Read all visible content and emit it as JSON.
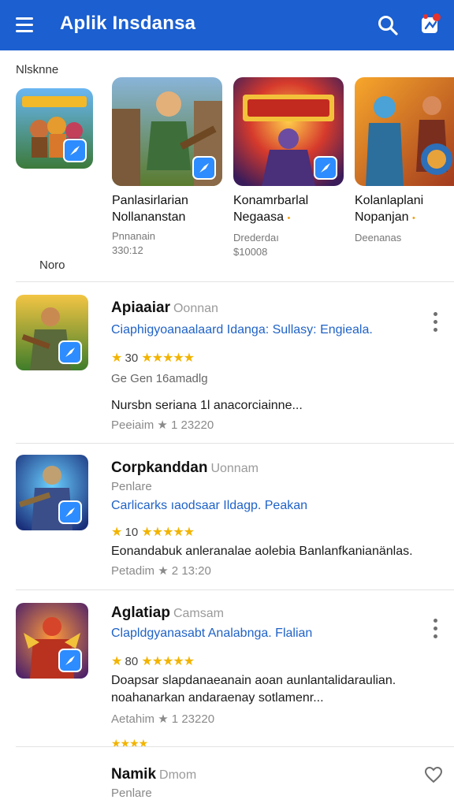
{
  "header": {
    "title": "Aplik Insdansa",
    "menu_icon": "menu-icon",
    "search_icon": "search-icon",
    "apps_icon": "app-badge-icon",
    "color": "#1b5fd0"
  },
  "featured": {
    "label": "Nlsknne",
    "sub_label": "Noro",
    "cards": [
      {
        "name_line1": "Panlasirlarian",
        "name_line2": "Nollananstan",
        "meta_line1": "Pnnanain",
        "meta_line2": "330:12",
        "marker": ""
      },
      {
        "name_line1": "Konamrbarlal",
        "name_line2": "Negaasa",
        "meta_line1": "Drederdaı",
        "meta_line2": "$10008",
        "marker": "•"
      },
      {
        "name_line1": "Kolanlaplani",
        "name_line2": "Nopanjan",
        "meta_line1": "Deenanas",
        "meta_line2": "",
        "marker": "•"
      }
    ]
  },
  "list": [
    {
      "title": "Apiaaiar",
      "developer": "Oonnan",
      "tagline": "Ciaphigyoanaalaard Idanga: Sullasy: Engieala.",
      "rating": "30",
      "stars": "★★★★★",
      "plain": "Ge Gen 16amadlg",
      "description": "Nursbn seriana 1l anacorciainne...",
      "footer": "Peeiaim ★ 1 23220"
    },
    {
      "title": "Corpkanddan",
      "developer": "Uonnam",
      "subtitle": "Penlare",
      "tagline": "Carlicarks ıaodsaar Ildagp. Peakan",
      "rating": "10",
      "stars": "★★★★★",
      "description": "Eonandabuk anleranalae aolebia Banlanfkanianänlas.",
      "footer": "Petadim ★ 2 13:20"
    },
    {
      "title": "Aglatiap",
      "developer": "Camsam",
      "tagline": "Clapldgyanasabt Analabnga. Flalian",
      "rating": "80",
      "stars": "★★★★★",
      "description": "Doapsar slapdanaeanain aoan aunlantalidaraulian. noahanarkan andaraenay sotlamenr...",
      "footer": "Aetahim ★ 1 23220",
      "trailing_stars": "★★★★"
    },
    {
      "title": "Namik",
      "developer": "Dmom",
      "subtitle": "Penlare"
    }
  ]
}
